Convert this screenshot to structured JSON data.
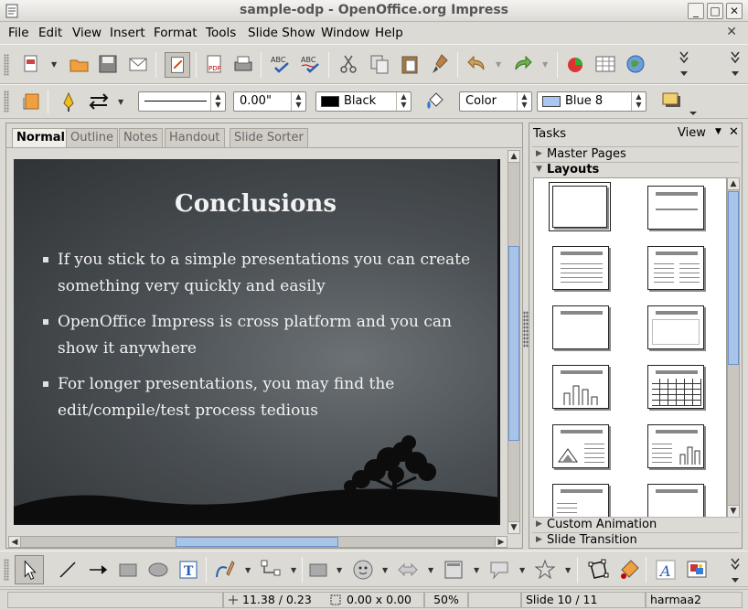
{
  "window": {
    "title": "sample-odp - OpenOffice.org Impress",
    "buttons": [
      "_",
      "□",
      "✕"
    ]
  },
  "menu": {
    "items": [
      "File",
      "Edit",
      "View",
      "Insert",
      "Format",
      "Tools",
      "Slide Show",
      "Window",
      "Help"
    ],
    "close": "✕"
  },
  "line_props": {
    "width_value": "0.00\"",
    "line_color": "Black",
    "area_style": "Color",
    "area_color": "Blue 8",
    "line_color_hex": "#000000",
    "area_color_hex": "#a9c7ef"
  },
  "view_tabs": [
    "Normal",
    "Outline",
    "Notes",
    "Handout",
    "Slide Sorter"
  ],
  "slide": {
    "title": "Conclusions",
    "bullets": [
      [
        "If you stick to a simple presentations you can create",
        "something very quickly and easily"
      ],
      [
        "OpenOffice Impress is cross platform and you can",
        "show it anywhere"
      ],
      [
        "For longer presentations, you may find the",
        "edit/compile/test process tedious"
      ]
    ]
  },
  "tasks": {
    "title": "Tasks",
    "view_label": "View",
    "sections": {
      "master_pages": "Master Pages",
      "layouts": "Layouts",
      "custom_animation": "Custom Animation",
      "slide_transition": "Slide Transition"
    }
  },
  "status": {
    "position": "11.38 / 0.23",
    "size": "0.00 x 0.00",
    "zoom": "50%",
    "slide": "Slide 10 / 11",
    "master": "harmaa2"
  }
}
